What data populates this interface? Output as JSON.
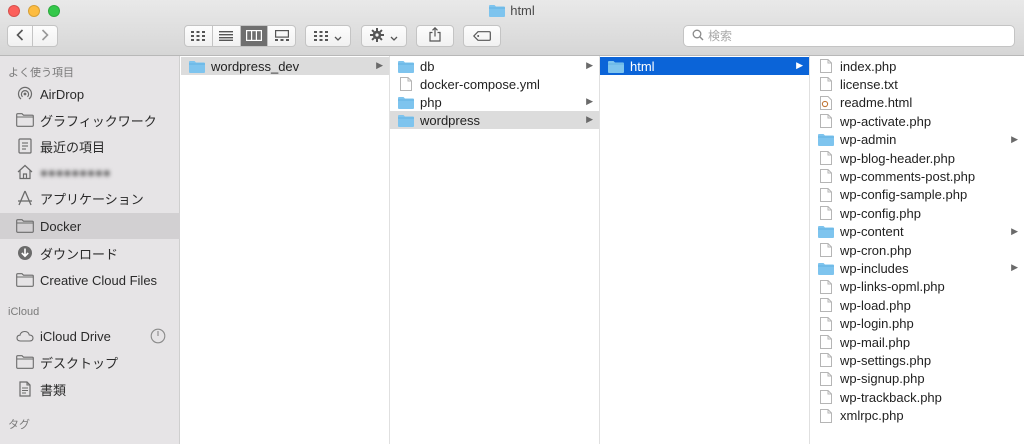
{
  "window": {
    "title": "html"
  },
  "search": {
    "placeholder": "検索"
  },
  "sidebar": {
    "favorites_header": "よく使う項目",
    "favorites": [
      "AirDrop",
      "グラフィックワーク",
      "最近の項目",
      "●●●●●●●●●",
      "アプリケーション",
      "Docker",
      "ダウンロード",
      "Creative Cloud Files"
    ],
    "icloud_header": "iCloud",
    "icloud": [
      "iCloud Drive",
      "デスクトップ",
      "書類"
    ],
    "tags_header": "タグ"
  },
  "columns": {
    "col1": [
      "wordpress_dev"
    ],
    "col2": [
      "db",
      "docker-compose.yml",
      "php",
      "wordpress"
    ],
    "col3": [
      "html"
    ],
    "col4": [
      "index.php",
      "license.txt",
      "readme.html",
      "wp-activate.php",
      "wp-admin",
      "wp-blog-header.php",
      "wp-comments-post.php",
      "wp-config-sample.php",
      "wp-config.php",
      "wp-content",
      "wp-cron.php",
      "wp-includes",
      "wp-links-opml.php",
      "wp-load.php",
      "wp-login.php",
      "wp-mail.php",
      "wp-settings.php",
      "wp-signup.php",
      "wp-trackback.php",
      "xmlrpc.php"
    ]
  },
  "colors": {
    "folder": "#7ec4ee",
    "selection_blue": "#0b64d8",
    "selection_gray": "#dcdcdc"
  }
}
